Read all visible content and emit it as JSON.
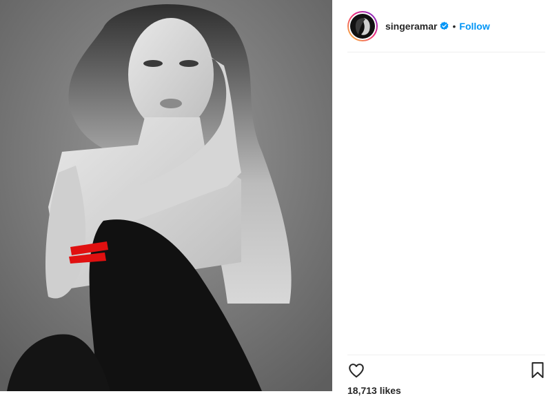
{
  "post": {
    "media": {
      "description_icon": "photo-image",
      "censor_mark_color": "#e01010"
    },
    "header": {
      "username": "singeramar",
      "verified_icon": "verified-badge-icon",
      "separator": "•",
      "follow_label": "Follow"
    },
    "actions": {
      "like_icon": "heart-outline-icon",
      "save_icon": "bookmark-outline-icon"
    },
    "likes_text": "18,713 likes"
  },
  "colors": {
    "accent": "#0095f6",
    "text": "#262626",
    "divider": "#efefef"
  }
}
